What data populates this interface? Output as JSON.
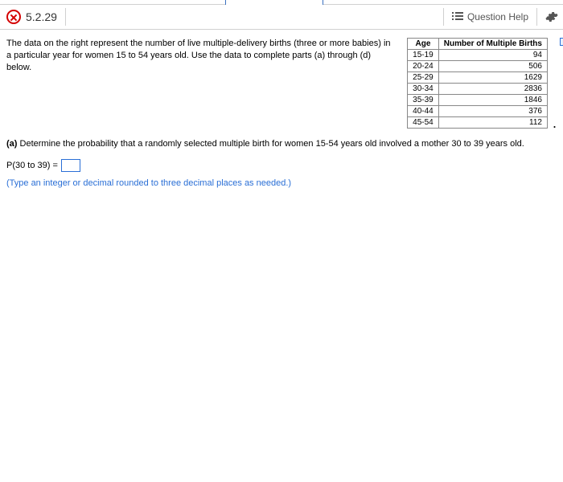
{
  "header": {
    "question_number": "5.2.29",
    "question_help_label": "Question Help"
  },
  "intro_text": "The data on the right represent the number of live multiple-delivery births (three or more babies) in a  particular year for women 15 to 54 years old. Use the data to complete parts (a) through (d) below.",
  "table": {
    "col1_header": "Age",
    "col2_header": "Number of Multiple Births",
    "rows": [
      {
        "age": "15-19",
        "value": "94"
      },
      {
        "age": "20-24",
        "value": "506"
      },
      {
        "age": "25-29",
        "value": "1629"
      },
      {
        "age": "30-34",
        "value": "2836"
      },
      {
        "age": "35-39",
        "value": "1846"
      },
      {
        "age": "40-44",
        "value": "376"
      },
      {
        "age": "45-54",
        "value": "112"
      }
    ]
  },
  "part_a": {
    "label": "(a)",
    "question": " Determine the probability that a randomly selected multiple birth for women 15-54 years old involved a mother 30 to 39 years old.",
    "answer_prefix": "P(30 to 39) =",
    "hint": "(Type an integer or decimal rounded to three decimal places as needed.)"
  }
}
